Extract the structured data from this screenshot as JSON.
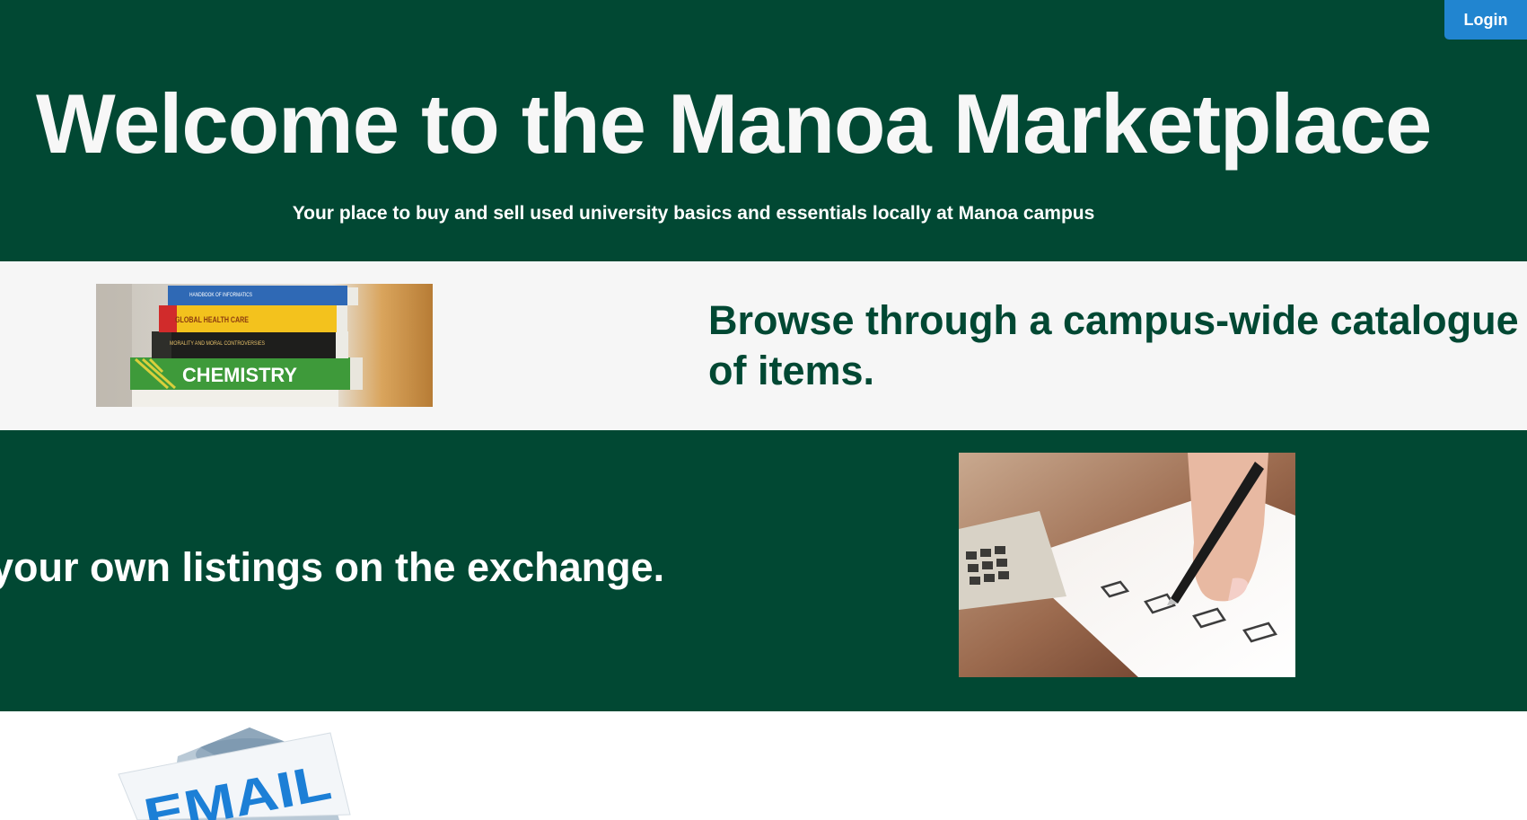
{
  "header": {
    "login_label": "Login"
  },
  "hero": {
    "title": "Welcome to the Manoa Marketplace",
    "subtitle": "Your place to buy and sell used university basics and essentials locally at Manoa campus"
  },
  "browse": {
    "heading": "Browse through a campus-wide catalogue of items.",
    "image_book_titles": [
      "HANDBOOK OF INFORMATICS",
      "GLOBAL HEALTH CARE",
      "MORALITY AND MORAL CONTROVERSIES",
      "CHEMISTRY"
    ]
  },
  "listings": {
    "heading": "your own listings on the exchange."
  },
  "email": {
    "image_label": "EMAIL"
  },
  "colors": {
    "brand_green": "#014833",
    "light_band": "#f6f6f6",
    "login_blue": "#2185d0"
  }
}
